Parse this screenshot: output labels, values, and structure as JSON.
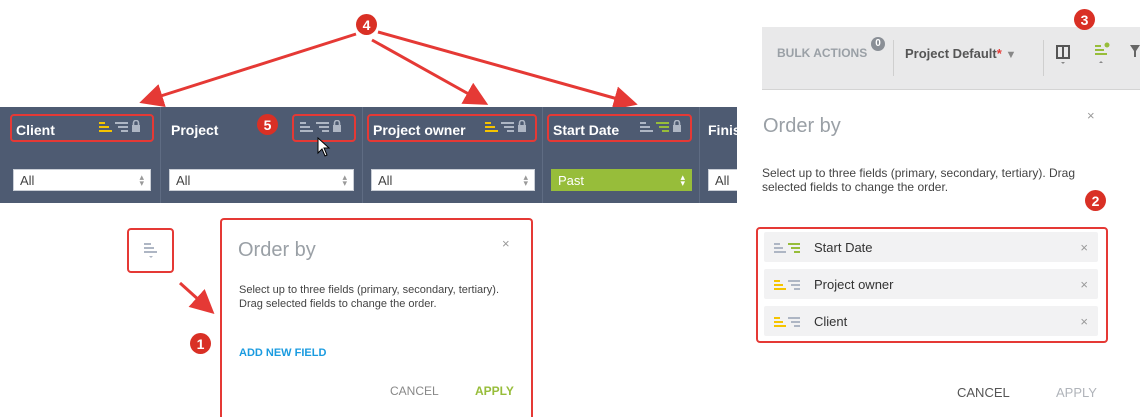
{
  "badges": {
    "n1": "1",
    "n2": "2",
    "n3": "3",
    "n4": "4",
    "n5": "5"
  },
  "columns": {
    "client": {
      "title": "Client",
      "filter": "All"
    },
    "project": {
      "title": "Project",
      "filter": "All"
    },
    "owner": {
      "title": "Project owner",
      "filter": "All"
    },
    "start": {
      "title": "Start Date",
      "filter": "Past"
    },
    "finish": {
      "title": "Finis",
      "filter": "All"
    }
  },
  "left_dialog": {
    "title": "Order by",
    "close": "×",
    "description": "Select up to three fields (primary, secondary, tertiary). Drag selected fields to change the order.",
    "add_field": "ADD NEW FIELD",
    "cancel": "CANCEL",
    "apply": "APPLY"
  },
  "toolbar": {
    "bulk_actions": "BULK ACTIONS",
    "bulk_count": "0",
    "view_name": "Project Default",
    "view_modified": "*"
  },
  "right_dialog": {
    "title": "Order by",
    "close": "×",
    "description": "Select up to three fields (primary, secondary, tertiary). Drag selected fields to change the order.",
    "fields": [
      {
        "label": "Start Date",
        "remove": "×"
      },
      {
        "label": "Project owner",
        "remove": "×"
      },
      {
        "label": "Client",
        "remove": "×"
      }
    ],
    "cancel": "CANCEL",
    "apply": "APPLY"
  },
  "colors": {
    "header_bg": "#4e5b72",
    "annotation_red": "#e53935",
    "sort_yellow": "#f5c400",
    "sort_green": "#97bd3a",
    "link_blue": "#1a9be0"
  }
}
